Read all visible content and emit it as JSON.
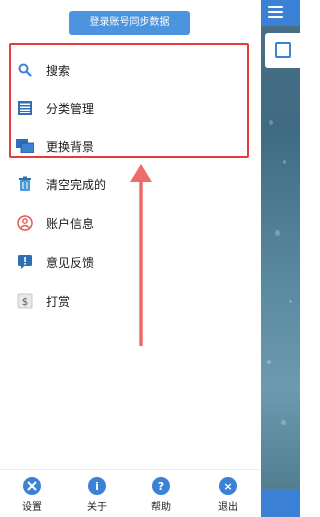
{
  "login_button": "登录账号同步数据",
  "menu": [
    {
      "label": "搜索",
      "icon": "search-icon"
    },
    {
      "label": "分类管理",
      "icon": "list-icon"
    },
    {
      "label": "更换背景",
      "icon": "background-icon"
    },
    {
      "label": "清空完成的",
      "icon": "trash-icon"
    },
    {
      "label": "账户信息",
      "icon": "account-icon"
    },
    {
      "label": "意见反馈",
      "icon": "feedback-icon"
    },
    {
      "label": "打赏",
      "icon": "reward-icon"
    }
  ],
  "bottom": [
    {
      "label": "设置",
      "icon": "settings-icon",
      "glyph": "✕"
    },
    {
      "label": "关于",
      "icon": "info-icon",
      "glyph": "i"
    },
    {
      "label": "帮助",
      "icon": "help-icon",
      "glyph": "?"
    },
    {
      "label": "退出",
      "icon": "exit-icon",
      "glyph": "×"
    }
  ],
  "colors": {
    "accent": "#3b82d6",
    "highlight": "#e63b3b",
    "arrow": "#ee6b6b"
  }
}
